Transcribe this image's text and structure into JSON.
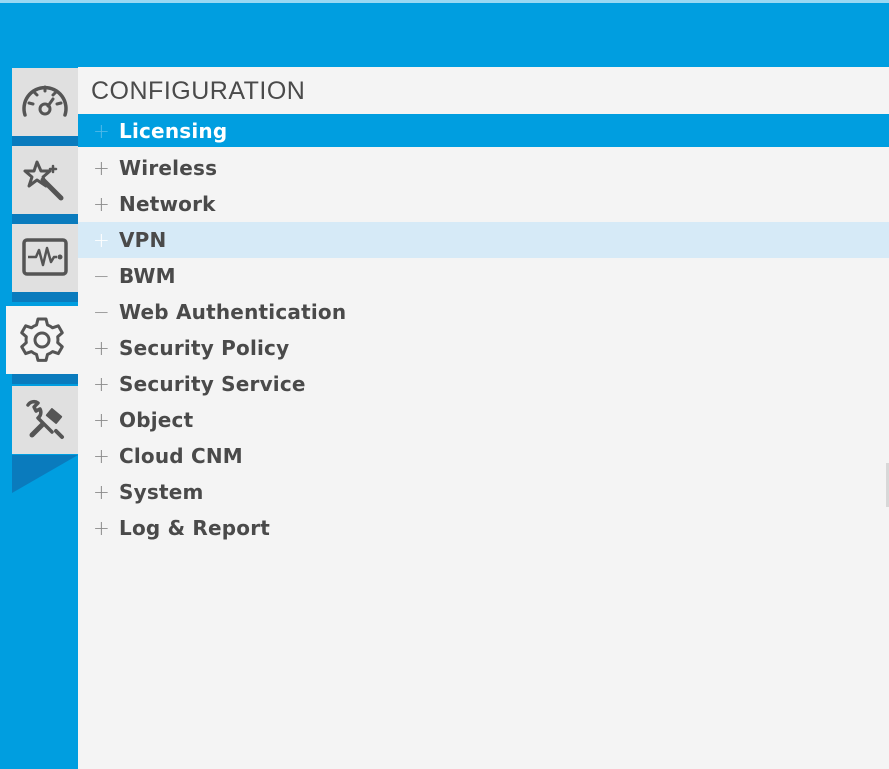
{
  "sidebar": {
    "tabs": [
      {
        "name": "dashboard",
        "icon": "speedometer-icon"
      },
      {
        "name": "quick-setup",
        "icon": "magic-wand-icon"
      },
      {
        "name": "monitor",
        "icon": "pulse-monitor-icon"
      },
      {
        "name": "configuration",
        "icon": "gear-icon",
        "active": true
      },
      {
        "name": "maintenance",
        "icon": "tools-icon"
      }
    ]
  },
  "panel": {
    "title": "CONFIGURATION",
    "items": [
      {
        "label": "Licensing",
        "sign": "+",
        "state": "selected"
      },
      {
        "label": "Wireless",
        "sign": "+"
      },
      {
        "label": "Network",
        "sign": "+"
      },
      {
        "label": "VPN",
        "sign": "+",
        "state": "hover"
      },
      {
        "label": "BWM",
        "sign": "−"
      },
      {
        "label": "Web Authentication",
        "sign": "−"
      },
      {
        "label": "Security Policy",
        "sign": "+"
      },
      {
        "label": "Security Service",
        "sign": "+"
      },
      {
        "label": "Object",
        "sign": "+"
      },
      {
        "label": "Cloud CNM",
        "sign": "+"
      },
      {
        "label": "System",
        "sign": "+"
      },
      {
        "label": "Log & Report",
        "sign": "+"
      }
    ]
  },
  "colors": {
    "brand": "#009ee0",
    "panel_bg": "#f4f4f4",
    "hover_bg": "#d6eaf7",
    "text": "#4a4a4a"
  }
}
